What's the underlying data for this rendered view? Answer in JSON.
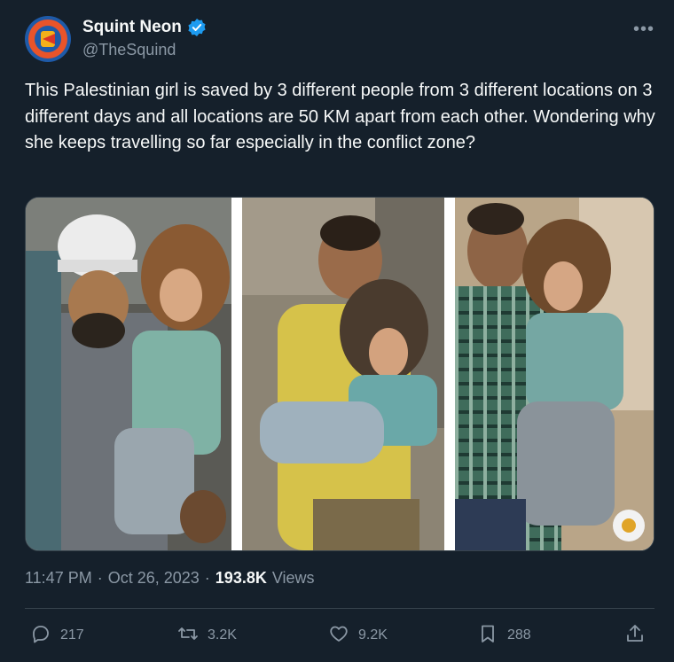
{
  "author": {
    "display_name": "Squint Neon",
    "handle": "@TheSquind",
    "verified": true
  },
  "tweet": {
    "text": "This Palestinian girl is saved by 3 different people from 3 different locations on 3 different days and all locations are 50 KM apart from each other. Wondering why she keeps travelling so far especially in the conflict zone?",
    "time": "11:47 PM",
    "date": "Oct 26, 2023",
    "views_count": "193.8K",
    "views_label": "Views"
  },
  "actions": {
    "replies": "217",
    "reposts": "3.2K",
    "likes": "9.2K",
    "bookmarks": "288"
  },
  "colors": {
    "background": "#15202b",
    "text": "#f7f9f9",
    "muted": "#8b98a5",
    "verified": "#1d9bf0",
    "divider": "#38444d"
  }
}
